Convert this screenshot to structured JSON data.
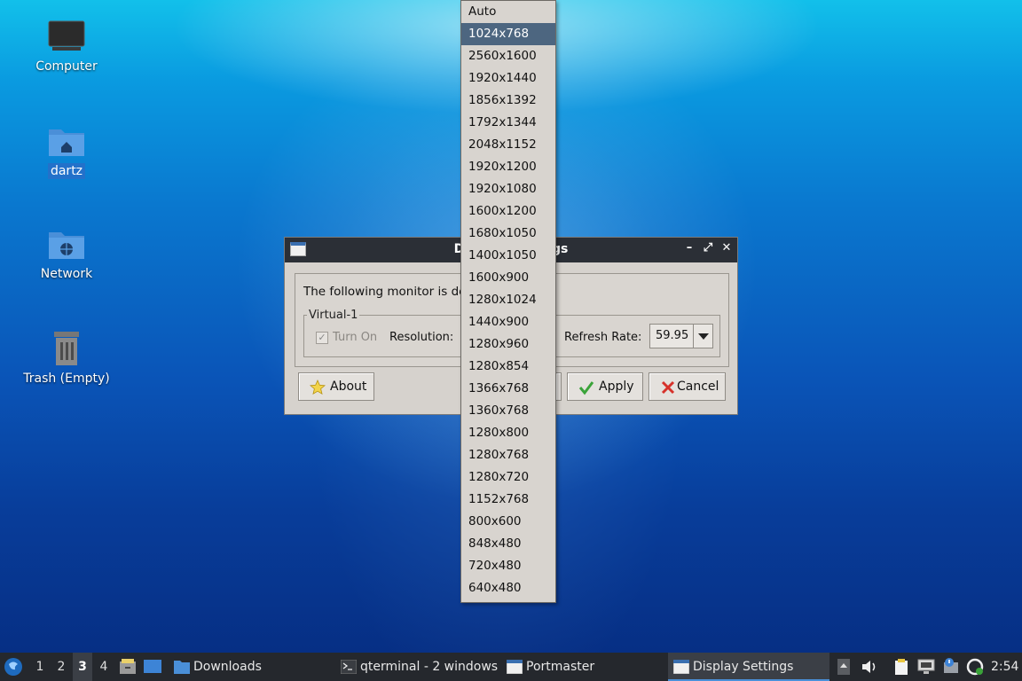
{
  "desktop": {
    "icons": [
      {
        "label": "Computer",
        "icon": "computer-icon"
      },
      {
        "label": "dartz",
        "icon": "home-folder-icon"
      },
      {
        "label": "Network",
        "icon": "network-folder-icon"
      },
      {
        "label": "Trash (Empty)",
        "icon": "trash-icon"
      }
    ]
  },
  "dialog": {
    "title": "Display Settings",
    "message": "The following monitor is detected:",
    "group_label": "Virtual-1",
    "turn_on_label": "Turn On",
    "resolution_label": "Resolution:",
    "refresh_rate_label": "Refresh Rate:",
    "refresh_rate_value": "59.95",
    "buttons": {
      "about": "About",
      "apply": "Apply",
      "cancel": "Cancel"
    }
  },
  "resolution_dropdown": {
    "selected": "1024x768",
    "options": [
      "Auto",
      "1024x768",
      "2560x1600",
      "1920x1440",
      "1856x1392",
      "1792x1344",
      "2048x1152",
      "1920x1200",
      "1920x1080",
      "1600x1200",
      "1680x1050",
      "1400x1050",
      "1600x900",
      "1280x1024",
      "1440x900",
      "1280x960",
      "1280x854",
      "1366x768",
      "1360x768",
      "1280x800",
      "1280x768",
      "1280x720",
      "1152x768",
      "800x600",
      "848x480",
      "720x480",
      "640x480"
    ]
  },
  "taskbar": {
    "workspaces": [
      "1",
      "2",
      "3",
      "4"
    ],
    "current_workspace": "3",
    "tasks": [
      {
        "label": "Downloads",
        "icon": "folder-icon"
      },
      {
        "label": "qterminal - 2 windows",
        "icon": "terminal-icon"
      },
      {
        "label": "Portmaster",
        "icon": "window-icon"
      },
      {
        "label": "Display Settings",
        "icon": "window-icon"
      }
    ],
    "clock": "2:54"
  },
  "colors": {
    "selection": "#4d6680",
    "titlebar": "#2b2f36",
    "taskbar": "#25282d",
    "dialog_bg": "#d6d2cd"
  }
}
